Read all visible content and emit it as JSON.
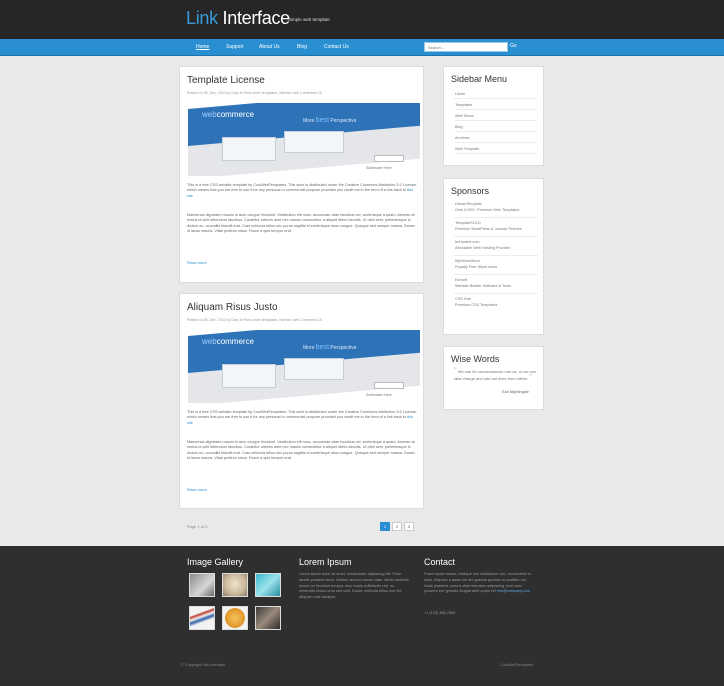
{
  "header": {
    "logo_part1": "Link",
    "logo_part2": "Interface",
    "slogan": "Simple web template"
  },
  "nav": {
    "items": [
      "Home",
      "Support",
      "About Us",
      "Blog",
      "Contact Us"
    ],
    "active": 0,
    "search_placeholder": "Search...",
    "search_button": "Go"
  },
  "posts": [
    {
      "title": "Template License",
      "meta": "Posted on 08, Dec, 2010 by Gary in Filed under templates, internet, web Comments 15",
      "banner": {
        "brand_a": "web",
        "brand_b": "commerce",
        "headline_a": "More",
        "headline_b": "best",
        "headline_c": "Perspective",
        "subtext": "Subheader Here"
      },
      "p1_text": "This is a free CSS website template by CoolWebTemplates. This work is distributed under the Creative Commons Attribution 3.0 License, which means that you are free to use it for any personal or commercial purpose provided you credit me in the form of a link back to",
      "p1_link": "this site",
      "p2": "Maecenas dignissim mauris in arcu congue tincidunt. Vestibulum elit nunc, accumsan vitae faucibus vel, scelerisque a quam. Aenean at metus id velit bibendum faucibus. Curabitur ultrices ante nec mauris consectetur a aliquet libero lobortis. Ut nibh sem, pellentesque in dictum eu, convallis blandit erat. Cras vehicula tellus nec purus sagittis id scelerisque risus congue. Quisque sed semper massa. Donec id lacus mauris. Vitae pretium nisus. Fusce a quis tempor erat.",
      "read_more": "Read more"
    },
    {
      "title": "Aliquam Risus Justo",
      "meta": "Posted on 08, Dec, 2010 by Gary in Filed under templates, internet, web Comments 15",
      "banner": {
        "brand_a": "web",
        "brand_b": "commerce",
        "headline_a": "More",
        "headline_b": "best",
        "headline_c": "Perspective",
        "subtext": "Subheader Here"
      },
      "p1_text": "This is a free CSS website template by CoolWebTemplates. This work is distributed under the Creative Commons Attribution 3.0 License, which means that you are free to use it for any personal or commercial purpose provided you credit me in the form of a link back to",
      "p1_link": "this site",
      "p2": "Maecenas dignissim mauris in arcu congue tincidunt. Vestibulum elit nunc, accumsan vitae faucibus vel, scelerisque a quam. Aenean at metus id velit bibendum faucibus. Curabitur ultrices ante nec mauris consectetur a aliquet libero lobortis. Ut nibh sem, pellentesque in dictum eu, convallis blandit erat. Cras vehicula tellus nec purus sagittis id scelerisque risus congue. Quisque sed semper massa. Donec id lacus mauris. Vitae pretium nisus. Fusce a quis tempor erat.",
      "read_more": "Read more"
    }
  ],
  "pagination": {
    "info": "Page 1 of 3",
    "pages": [
      "1",
      "2",
      "3"
    ],
    "current": 0
  },
  "sidebar_menu": {
    "title": "Sidebar Menu",
    "items": [
      "Home",
      "Templates",
      "Web Demo",
      "Blog",
      "Archives",
      "Web Template"
    ]
  },
  "sponsors": {
    "title": "Sponsors",
    "items": [
      {
        "name": "DreamTemplate",
        "desc": "Over 6,000+ Premium Web Templates"
      },
      {
        "name": "TemplateSOLD",
        "desc": "Premium WordPress & Joomla Themes"
      },
      {
        "name": "ImHosted.com",
        "desc": "Affordable Web Hosting Provider"
      },
      {
        "name": "MyVectorStore",
        "desc": "Royalty Free Stock Icons"
      },
      {
        "name": "Evrsoft",
        "desc": "Website Builder Software & Tools"
      },
      {
        "name": "CSS Hub",
        "desc": "Premium CSS Templates"
      }
    ]
  },
  "wise_words": {
    "title": "Wise Words",
    "open_quote": "“",
    "close_quote": "”",
    "quote": "We can let circumstances rule us, or we can take charge and rule our lives from within.",
    "author": "Earl Nightingale"
  },
  "footer": {
    "gallery_title": "Image Gallery",
    "lorem_title": "Lorem Ipsum",
    "lorem_text": "Lorem ipsum dolor sit amet, consectetur adipiscing elit. Proin iaculis posuere lacus. Nullam laoreet cursus vitae. Morbi molestie, ipsum vel tincidunt tempor, arcu turpis sollicitudin nisi, eu venenatis lectus urna sed velit. Donec vehicula tellus non elit. Aliquam erat volutpat.",
    "contact_title": "Contact",
    "contact_text": "Fusce quam metus, tristique non vestibulum nec, consectetur in risus. Aliquam a quam vel leo gravida gravida eu porttitor dui. Nulla pharetra, mauris vitae interdum adipiscing, erat nunc posuere est, gravida feugiat ante quam vel",
    "contact_email": "info@company.com",
    "contact_phone": "+1 (123) 456-7890",
    "copyright": "© Copyright Link Interface",
    "credit_label": "CoolWebTemplates"
  }
}
